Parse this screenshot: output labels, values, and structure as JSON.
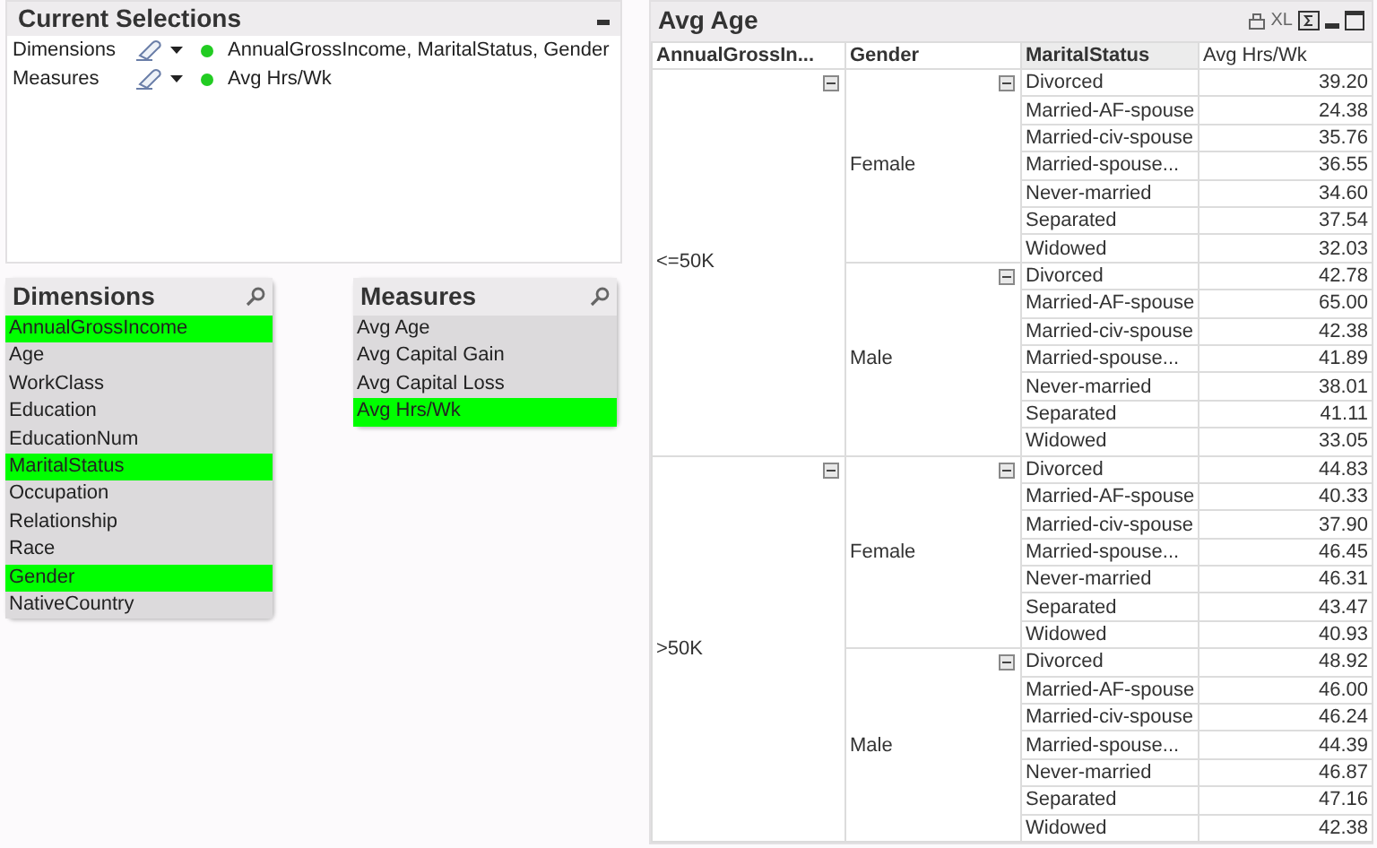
{
  "current_selections": {
    "title": "Current Selections",
    "rows": [
      {
        "field": "Dimensions",
        "values": "AnnualGrossIncome, MaritalStatus, Gender"
      },
      {
        "field": "Measures",
        "values": "Avg Hrs/Wk"
      }
    ]
  },
  "dimensions": {
    "title": "Dimensions",
    "items": [
      {
        "label": "AnnualGrossIncome",
        "selected": true
      },
      {
        "label": "Age",
        "selected": false
      },
      {
        "label": "WorkClass",
        "selected": false
      },
      {
        "label": "Education",
        "selected": false
      },
      {
        "label": "EducationNum",
        "selected": false
      },
      {
        "label": "MaritalStatus",
        "selected": true
      },
      {
        "label": "Occupation",
        "selected": false
      },
      {
        "label": "Relationship",
        "selected": false
      },
      {
        "label": "Race",
        "selected": false
      },
      {
        "label": "Gender",
        "selected": true
      },
      {
        "label": "NativeCountry",
        "selected": false
      }
    ]
  },
  "measures": {
    "title": "Measures",
    "items": [
      {
        "label": "Avg Age",
        "selected": false
      },
      {
        "label": "Avg Capital Gain",
        "selected": false
      },
      {
        "label": "Avg Capital Loss",
        "selected": false
      },
      {
        "label": "Avg Hrs/Wk",
        "selected": true
      }
    ]
  },
  "pivot": {
    "title": "Avg Age",
    "toolbar": [
      "XL"
    ],
    "columns": [
      "AnnualGrossIn...",
      "Gender",
      "MaritalStatus",
      "Avg Hrs/Wk"
    ],
    "incomes": [
      {
        "label": "<=50K",
        "groups": [
          {
            "gender": "Female",
            "rows": [
              [
                "Divorced",
                "39.20"
              ],
              [
                "Married-AF-spouse",
                "24.38"
              ],
              [
                "Married-civ-spouse",
                "35.76"
              ],
              [
                "Married-spouse...",
                "36.55"
              ],
              [
                "Never-married",
                "34.60"
              ],
              [
                "Separated",
                "37.54"
              ],
              [
                "Widowed",
                "32.03"
              ]
            ]
          },
          {
            "gender": "Male",
            "rows": [
              [
                "Divorced",
                "42.78"
              ],
              [
                "Married-AF-spouse",
                "65.00"
              ],
              [
                "Married-civ-spouse",
                "42.38"
              ],
              [
                "Married-spouse...",
                "41.89"
              ],
              [
                "Never-married",
                "38.01"
              ],
              [
                "Separated",
                "41.11"
              ],
              [
                "Widowed",
                "33.05"
              ]
            ]
          }
        ]
      },
      {
        "label": ">50K",
        "groups": [
          {
            "gender": "Female",
            "rows": [
              [
                "Divorced",
                "44.83"
              ],
              [
                "Married-AF-spouse",
                "40.33"
              ],
              [
                "Married-civ-spouse",
                "37.90"
              ],
              [
                "Married-spouse...",
                "46.45"
              ],
              [
                "Never-married",
                "46.31"
              ],
              [
                "Separated",
                "43.47"
              ],
              [
                "Widowed",
                "40.93"
              ]
            ]
          },
          {
            "gender": "Male",
            "rows": [
              [
                "Divorced",
                "48.92"
              ],
              [
                "Married-AF-spouse",
                "46.00"
              ],
              [
                "Married-civ-spouse",
                "46.24"
              ],
              [
                "Married-spouse...",
                "44.39"
              ],
              [
                "Never-married",
                "46.87"
              ],
              [
                "Separated",
                "47.16"
              ],
              [
                "Widowed",
                "42.38"
              ]
            ]
          }
        ]
      }
    ]
  }
}
